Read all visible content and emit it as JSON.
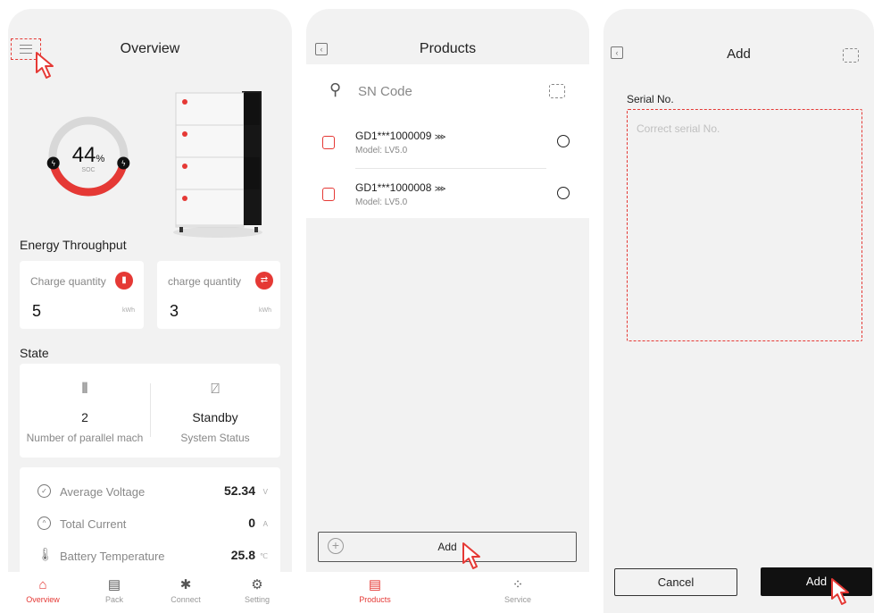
{
  "colors": {
    "accent": "#e53935",
    "background": "#f2f2f2",
    "card": "#ffffff",
    "dark_button": "#111111"
  },
  "overview": {
    "title": "Overview",
    "soc": {
      "value": "44",
      "unit": "%",
      "label": "SOC",
      "percent": 44
    },
    "energy_section_title": "Energy Throughput",
    "energy_cards": [
      {
        "label": "Charge quantity",
        "value": "5",
        "unit": "kWh",
        "icon": "charge-icon"
      },
      {
        "label": "charge quantity",
        "value": "3",
        "unit": "kWh",
        "icon": "discharge-icon"
      }
    ],
    "state_section_title": "State",
    "state": [
      {
        "value": "2",
        "label": "Number of parallel mach",
        "icon": "parallel-icon"
      },
      {
        "value": "Standby",
        "label": "System Status",
        "icon": "monitor-icon"
      }
    ],
    "metrics": [
      {
        "label": "Average Voltage",
        "value": "52.34",
        "unit": "V",
        "icon": "voltage-icon"
      },
      {
        "label": "Total Current",
        "value": "0",
        "unit": "A",
        "icon": "current-icon"
      },
      {
        "label": "Battery Temperature",
        "value": "25.8",
        "unit": "℃",
        "icon": "thermometer-icon"
      }
    ],
    "tabs": [
      {
        "label": "Overview",
        "icon": "home-icon",
        "active": true
      },
      {
        "label": "Pack",
        "icon": "pack-icon",
        "active": false
      },
      {
        "label": "Connect",
        "icon": "bluetooth-icon",
        "active": false
      },
      {
        "label": "Setting",
        "icon": "gear-icon",
        "active": false
      }
    ]
  },
  "products": {
    "title": "Products",
    "search_placeholder": "SN Code",
    "items": [
      {
        "sn": "GD1***1000009",
        "model": "Model: LV5.0"
      },
      {
        "sn": "GD1***1000008",
        "model": "Model: LV5.0"
      }
    ],
    "add_label": "Add",
    "tabs": [
      {
        "label": "Products",
        "icon": "products-icon",
        "active": true
      },
      {
        "label": "Service",
        "icon": "service-icon",
        "active": false
      }
    ]
  },
  "add": {
    "title": "Add",
    "serial_label": "Serial No.",
    "serial_placeholder": "Correct serial No.",
    "cancel_label": "Cancel",
    "add_label": "Add"
  }
}
